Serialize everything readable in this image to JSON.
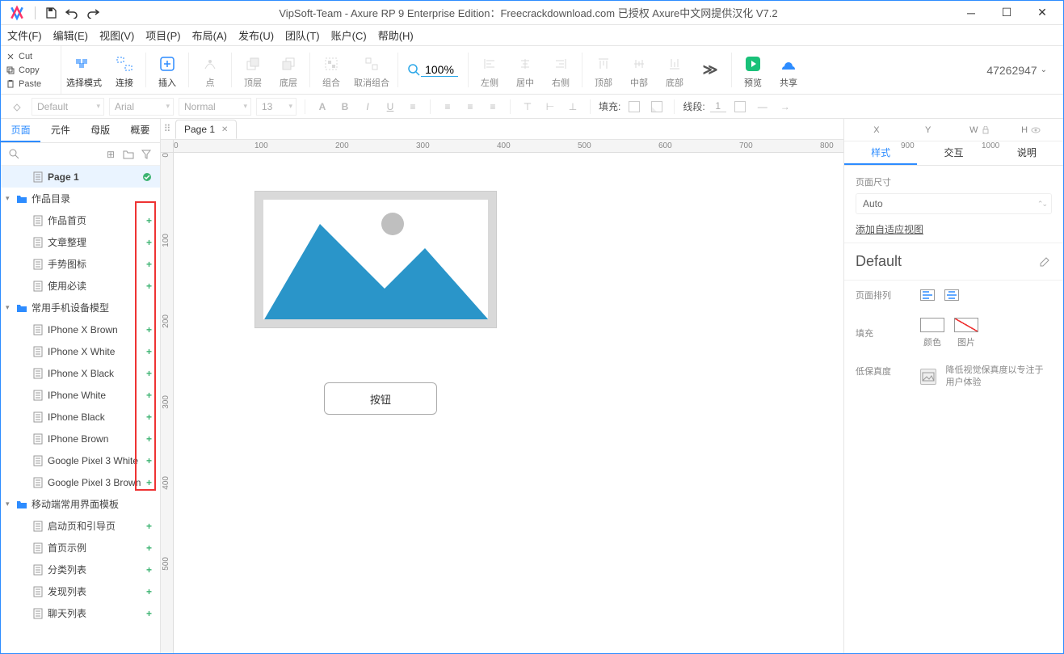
{
  "titlebar": {
    "title": "VipSoft-Team - Axure RP 9 Enterprise Edition：Freecrackdownload.com 已授权    Axure中文网提供汉化 V7.2"
  },
  "menu": {
    "file": "文件(F)",
    "edit": "编辑(E)",
    "view": "视图(V)",
    "project": "项目(P)",
    "arrange": "布局(A)",
    "publish": "发布(U)",
    "team": "团队(T)",
    "account": "账户(C)",
    "help": "帮助(H)"
  },
  "clip": {
    "cut": "Cut",
    "copy": "Copy",
    "paste": "Paste"
  },
  "toolbar": {
    "select": "选择模式",
    "connect": "连接",
    "insert": "插入",
    "point": "点",
    "front": "顶层",
    "back": "底层",
    "group": "组合",
    "ungroup": "取消组合",
    "zoom": "100%",
    "alignLeft": "左侧",
    "alignCenter": "居中",
    "alignRight": "右侧",
    "alignTop": "顶部",
    "alignMiddle": "中部",
    "alignBottom": "底部",
    "preview": "预览",
    "share": "共享",
    "account": "47262947"
  },
  "fmt": {
    "preset": "Default",
    "font": "Arial",
    "weight": "Normal",
    "size": "13",
    "fillLabel": "填充:",
    "strokeLabel": "线段:",
    "strokeVal": "1"
  },
  "leftTabs": {
    "page": "页面",
    "widget": "元件",
    "master": "母版",
    "outline": "概要"
  },
  "canvasTab": "Page 1",
  "ruler": {
    "h": [
      "0",
      "100",
      "200",
      "300",
      "400",
      "500",
      "600",
      "700",
      "800",
      "900",
      "1000"
    ],
    "v": [
      "0",
      "100",
      "200",
      "300",
      "400",
      "500"
    ]
  },
  "tree": [
    {
      "type": "page",
      "name": "Page 1",
      "indent": 1,
      "selected": true,
      "bold": true,
      "mark": "check"
    },
    {
      "type": "folder",
      "name": "作品目录",
      "indent": 0,
      "open": true
    },
    {
      "type": "page",
      "name": "作品首页",
      "indent": 1,
      "mark": "plus"
    },
    {
      "type": "page",
      "name": "文章整理",
      "indent": 1,
      "mark": "plus"
    },
    {
      "type": "page",
      "name": "手势图标",
      "indent": 1,
      "mark": "plus"
    },
    {
      "type": "page",
      "name": "使用必读",
      "indent": 1,
      "mark": "plus"
    },
    {
      "type": "folder",
      "name": "常用手机设备模型",
      "indent": 0,
      "open": true
    },
    {
      "type": "page",
      "name": "IPhone X Brown",
      "indent": 1,
      "mark": "plus"
    },
    {
      "type": "page",
      "name": "IPhone X White",
      "indent": 1,
      "mark": "plus"
    },
    {
      "type": "page",
      "name": "IPhone X Black",
      "indent": 1,
      "mark": "plus"
    },
    {
      "type": "page",
      "name": "IPhone White",
      "indent": 1,
      "mark": "plus"
    },
    {
      "type": "page",
      "name": "IPhone Black",
      "indent": 1,
      "mark": "plus"
    },
    {
      "type": "page",
      "name": "IPhone Brown",
      "indent": 1,
      "mark": "plus"
    },
    {
      "type": "page",
      "name": "Google Pixel 3 White",
      "indent": 1,
      "mark": "plus"
    },
    {
      "type": "page",
      "name": "Google Pixel 3 Brown",
      "indent": 1,
      "mark": "plus"
    },
    {
      "type": "folder",
      "name": "移动端常用界面模板",
      "indent": 0,
      "open": true
    },
    {
      "type": "page",
      "name": "启动页和引导页",
      "indent": 1,
      "mark": "plus"
    },
    {
      "type": "page",
      "name": "首页示例",
      "indent": 1,
      "mark": "plus"
    },
    {
      "type": "page",
      "name": "分类列表",
      "indent": 1,
      "mark": "plus"
    },
    {
      "type": "page",
      "name": "发现列表",
      "indent": 1,
      "mark": "plus"
    },
    {
      "type": "page",
      "name": "聊天列表",
      "indent": 1,
      "mark": "plus"
    }
  ],
  "widgets": {
    "buttonLabel": "按钮"
  },
  "rightTabs": {
    "style": "样式",
    "interact": "交互",
    "notes": "说明"
  },
  "inspector": {
    "dimX": "X",
    "dimY": "Y",
    "dimW": "W",
    "dimH": "H",
    "sizeLabel": "页面尺寸",
    "sizeValue": "Auto",
    "addView": "添加自适应视图",
    "defaultLabel": "Default",
    "alignLabel": "页面排列",
    "fillLabel": "填充",
    "fillColor": "颜色",
    "fillImage": "图片",
    "lofiLabel": "低保真度",
    "lofiHint": "降低视觉保真度以专注于用户体验"
  }
}
